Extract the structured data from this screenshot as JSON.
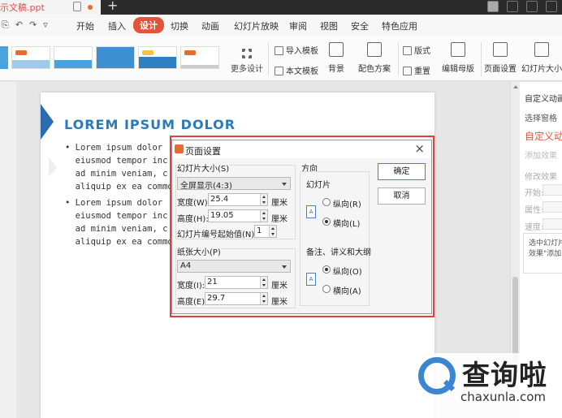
{
  "titlebar": {
    "doc_title": "示文稿.ppt"
  },
  "menu": {
    "items": [
      "开始",
      "插入",
      "设计",
      "切换",
      "动画",
      "幻灯片放映",
      "审阅",
      "视图",
      "安全",
      "特色应用"
    ],
    "active": "设计"
  },
  "ribbon": {
    "more_design": "更多设计",
    "import_template": "导入模板",
    "text_template": "本文模板",
    "background": "背景",
    "color_scheme": "配色方案",
    "layout": "版式",
    "reset": "重置",
    "edit_master": "编辑母版",
    "page_setup": "页面设置",
    "slide_size": "幻灯片大小"
  },
  "slide": {
    "title": "LOREM IPSUM DOLOR",
    "bullet1": [
      "• Lorem ipsum dolor",
      "  eiusmod tempor inc",
      "  ad minim veniam, c",
      "  aliquip ex ea commo"
    ],
    "bullet2": [
      "• Lorem ipsum dolor",
      "  eiusmod tempor inc",
      "  ad minim veniam, c",
      "  aliquip ex ea commo"
    ]
  },
  "right_pane": {
    "header": "自定义动画",
    "select_pane": "选择窗格",
    "custom_anim": "自定义动画",
    "add_effect": "添加效果",
    "modify_effect": "修改效果",
    "start": "开始:",
    "property": "属性:",
    "speed": "速度:",
    "hint": "选中幻灯片，\n效果\"添加"
  },
  "dialog": {
    "title": "页面设置",
    "slide_size_label": "幻灯片大小(S)",
    "slide_size_value": "全屏显示(4:3)",
    "width_label": "宽度(W):",
    "width_value": "25.4",
    "height_label": "高度(H):",
    "height_value": "19.05",
    "unit": "厘米",
    "start_num_label": "幻灯片编号起始值(N):",
    "start_num_value": "1",
    "paper_size_label": "纸张大小(P)",
    "paper_size_value": "A4",
    "paper_width_label": "宽度(I):",
    "paper_width_value": "21",
    "paper_height_label": "高度(E):",
    "paper_height_value": "29.7",
    "orientation_label": "方向",
    "slide_label": "幻灯片",
    "portrait_r": "纵向(R)",
    "landscape_l": "横向(L)",
    "notes_label": "备注、讲义和大纲",
    "portrait_o": "纵向(O)",
    "landscape_a": "横向(A)",
    "ok": "确定",
    "cancel": "取消"
  },
  "watermark": {
    "brand": "查询啦",
    "url": "chaxunla.com"
  }
}
